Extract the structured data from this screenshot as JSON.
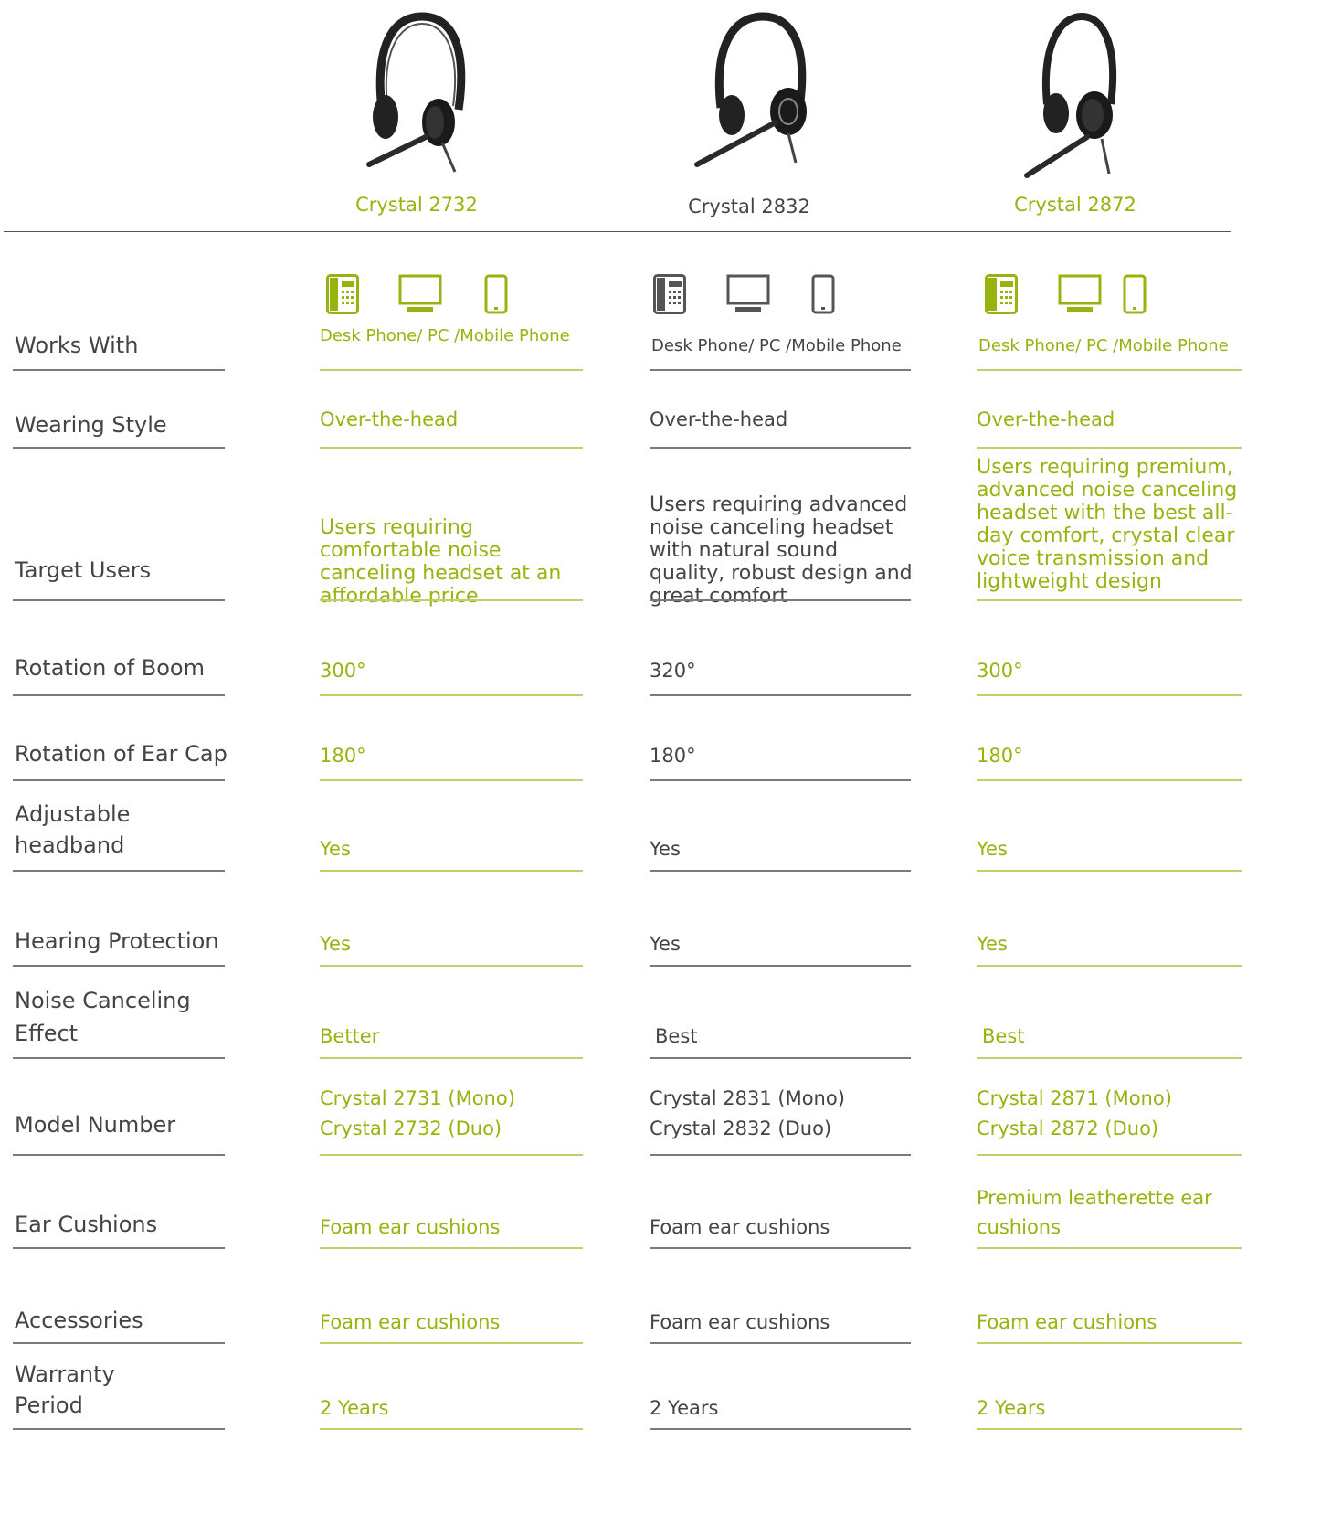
{
  "products": [
    {
      "name": "Crystal 2732",
      "accent": "#95b40f"
    },
    {
      "name": "Crystal 2832",
      "accent": "#444444"
    },
    {
      "name": "Crystal 2872",
      "accent": "#95b40f"
    }
  ],
  "icons": [
    "desk-phone-icon",
    "pc-monitor-icon",
    "mobile-phone-icon"
  ],
  "rows": {
    "works_with": {
      "label": "Works With",
      "values": [
        "Desk Phone/ PC /Mobile Phone",
        "Desk Phone/ PC /Mobile Phone",
        "Desk Phone/ PC /Mobile Phone"
      ]
    },
    "wearing_style": {
      "label": "Wearing Style",
      "values": [
        "Over-the-head",
        "Over-the-head",
        "Over-the-head"
      ]
    },
    "target_users": {
      "label": "Target Users",
      "values": [
        "Users requiring comfortable noise canceling headset at an affordable price",
        "Users requiring advanced noise canceling headset with natural sound quality, robust design and great comfort",
        "Users requiring premium, advanced noise canceling headset with the best all-day comfort, crystal clear voice transmission and lightweight design"
      ]
    },
    "rotation_boom": {
      "label": "Rotation of Boom",
      "values": [
        "300°",
        "320°",
        "300°"
      ]
    },
    "rotation_ear_cap": {
      "label": "Rotation of Ear Cap",
      "values": [
        "180°",
        "180°",
        "180°"
      ]
    },
    "adjustable_headband": {
      "label_line1": "Adjustable",
      "label_line2": "headband",
      "values": [
        "Yes",
        "Yes",
        "Yes"
      ]
    },
    "hearing_protection": {
      "label": "Hearing Protection",
      "values": [
        "Yes",
        "Yes",
        "Yes"
      ]
    },
    "noise_canceling": {
      "label_line1": "Noise Canceling",
      "label_line2": "Effect",
      "values": [
        "Better",
        "Best",
        "Best"
      ]
    },
    "model_number": {
      "label": "Model Number",
      "values": [
        [
          "Crystal 2731 (Mono)",
          "Crystal 2732 (Duo)"
        ],
        [
          "Crystal 2831 (Mono)",
          "Crystal 2832 (Duo)"
        ],
        [
          "Crystal 2871 (Mono)",
          "Crystal 2872 (Duo)"
        ]
      ]
    },
    "ear_cushions": {
      "label": "Ear Cushions",
      "values": [
        "Foam ear cushions",
        "Foam ear cushions",
        "Premium leatherette ear cushions"
      ]
    },
    "accessories": {
      "label": "Accessories",
      "values": [
        "Foam ear cushions",
        "Foam ear cushions",
        "Foam ear cushions"
      ]
    },
    "warranty": {
      "label_line1": "Warranty",
      "label_line2": "Period",
      "values": [
        "2 Years",
        "2 Years",
        "2 Years"
      ]
    }
  }
}
